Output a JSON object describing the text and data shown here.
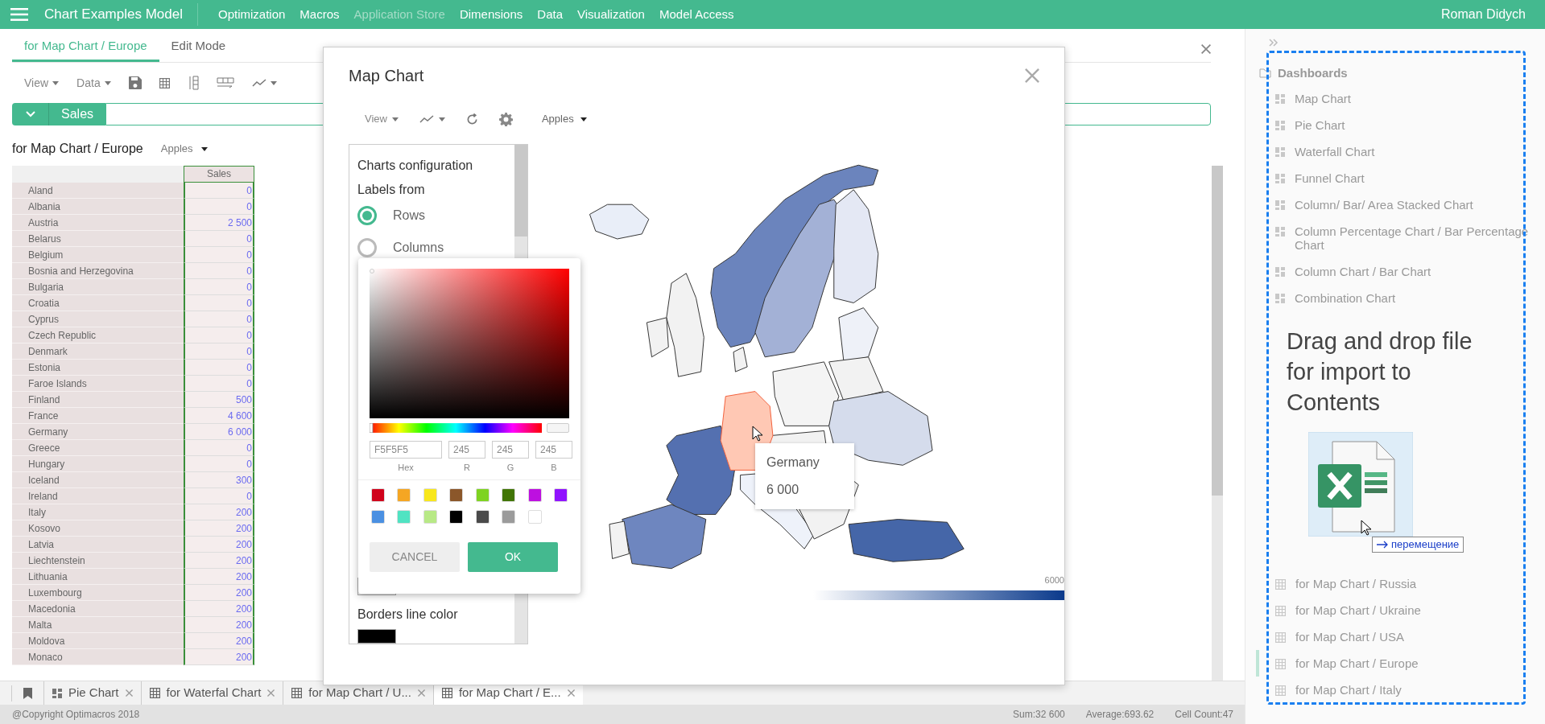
{
  "top_bar": {
    "app_title": "Chart Examples Model",
    "menu": [
      {
        "label": "Optimization",
        "disabled": false
      },
      {
        "label": "Macros",
        "disabled": false
      },
      {
        "label": "Application Store",
        "disabled": true
      },
      {
        "label": "Dimensions",
        "disabled": false
      },
      {
        "label": "Data",
        "disabled": false
      },
      {
        "label": "Visualization",
        "disabled": false
      },
      {
        "label": "Model Access",
        "disabled": false
      }
    ],
    "user": "Roman Didych"
  },
  "tabs": [
    {
      "label": "for Map Chart / Europe",
      "selected": true
    },
    {
      "label": "Edit Mode",
      "selected": false
    }
  ],
  "toolbar": {
    "view": "View",
    "data": "Data"
  },
  "sales_bar": {
    "label": "Sales"
  },
  "grid": {
    "title": "for Map Chart / Europe",
    "filter": "Apples",
    "column": "Sales",
    "rows": [
      {
        "name": "Aland",
        "value": "0"
      },
      {
        "name": "Albania",
        "value": "0"
      },
      {
        "name": "Austria",
        "value": "2 500"
      },
      {
        "name": "Belarus",
        "value": "0"
      },
      {
        "name": "Belgium",
        "value": "0"
      },
      {
        "name": "Bosnia and Herzegovina",
        "value": "0"
      },
      {
        "name": "Bulgaria",
        "value": "0"
      },
      {
        "name": "Croatia",
        "value": "0"
      },
      {
        "name": "Cyprus",
        "value": "0"
      },
      {
        "name": "Czech Republic",
        "value": "0"
      },
      {
        "name": "Denmark",
        "value": "0"
      },
      {
        "name": "Estonia",
        "value": "0"
      },
      {
        "name": "Faroe Islands",
        "value": "0"
      },
      {
        "name": "Finland",
        "value": "500"
      },
      {
        "name": "France",
        "value": "4 600"
      },
      {
        "name": "Germany",
        "value": "6 000"
      },
      {
        "name": "Greece",
        "value": "0"
      },
      {
        "name": "Hungary",
        "value": "0"
      },
      {
        "name": "Iceland",
        "value": "300"
      },
      {
        "name": "Ireland",
        "value": "0"
      },
      {
        "name": "Italy",
        "value": "200"
      },
      {
        "name": "Kosovo",
        "value": "200"
      },
      {
        "name": "Latvia",
        "value": "200"
      },
      {
        "name": "Liechtenstein",
        "value": "200"
      },
      {
        "name": "Lithuania",
        "value": "200"
      },
      {
        "name": "Luxembourg",
        "value": "200"
      },
      {
        "name": "Macedonia",
        "value": "200"
      },
      {
        "name": "Malta",
        "value": "200"
      },
      {
        "name": "Moldova",
        "value": "200"
      },
      {
        "name": "Monaco",
        "value": "200"
      }
    ]
  },
  "dialog": {
    "title": "Map Chart",
    "toolbar": {
      "view": "View",
      "filter": "Apples"
    },
    "config": {
      "title": "Charts configuration",
      "labels_from": "Labels from",
      "options": [
        {
          "label": "Rows",
          "selected": true
        },
        {
          "label": "Columns",
          "selected": false
        }
      ],
      "borders_label": "Borders line color"
    },
    "color_picker": {
      "hue": {
        "level": 0
      },
      "hex": "F5F5F5",
      "r": "245",
      "g": "245",
      "b": "245",
      "hex_label": "Hex",
      "r_label": "R",
      "g_label": "G",
      "b_label": "B",
      "swatches": [
        {
          "color": "#d0021b"
        },
        {
          "color": "#f5a623"
        },
        {
          "color": "#f8e71c"
        },
        {
          "color": "#8b572a"
        },
        {
          "color": "#7ed321"
        },
        {
          "color": "#417505"
        },
        {
          "color": "#bd10e0"
        },
        {
          "color": "#9013fe"
        },
        {
          "color": "#4a90e2"
        },
        {
          "color": "#50e3c2"
        },
        {
          "color": "#b8e986"
        },
        {
          "color": "#000000"
        },
        {
          "color": "#4a4a4a"
        },
        {
          "color": "#9b9b9b"
        },
        {
          "color": "#ffffff"
        }
      ],
      "cancel": "CANCEL",
      "ok": "OK"
    },
    "tooltip": {
      "country": "Germany",
      "value": "6 000"
    },
    "legend": {
      "max": "6000"
    }
  },
  "sidebar": {
    "sections": [
      {
        "title": "Dashboards",
        "kind": "dashboard",
        "items": [
          {
            "label": "Map Chart",
            "selected": false
          },
          {
            "label": "Pie Chart",
            "selected": false
          },
          {
            "label": "Waterfall Chart",
            "selected": false
          },
          {
            "label": "Funnel Chart",
            "selected": false
          },
          {
            "label": "Column/ Bar/ Area Stacked Chart",
            "selected": false
          },
          {
            "label": "Column Percentage Chart / Bar Percentage Chart",
            "selected": false
          },
          {
            "label": "Column Chart / Bar Chart",
            "selected": false
          },
          {
            "label": "Combination Chart",
            "selected": false
          }
        ]
      },
      {
        "kind": "grid",
        "items": [
          {
            "label": "for Map Chart / Russia",
            "selected": false
          },
          {
            "label": "for Map Chart / Ukraine",
            "selected": false
          },
          {
            "label": "for Map Chart / USA",
            "selected": false
          },
          {
            "label": "for Map Chart / Europe",
            "selected": true
          },
          {
            "label": "for Map Chart / Italy",
            "selected": false
          }
        ]
      }
    ],
    "drop_hint": "Drag and drop file for import to Contents",
    "drag_label": "перемещение"
  },
  "bottom_tabs": [
    {
      "label": "Pie Chart",
      "kind": "dashboard",
      "selected": false
    },
    {
      "label": "for Waterfal Chart",
      "kind": "grid",
      "selected": false
    },
    {
      "label": "for Map Chart / U...",
      "kind": "grid",
      "selected": false
    },
    {
      "label": "for Map Chart / E...",
      "kind": "grid",
      "selected": true
    }
  ],
  "status_bar": {
    "copyright": "@Copyright Optimacros 2018",
    "sum": "Sum:32 600",
    "average": "Average:693.62",
    "count": "Cell Count:47"
  }
}
